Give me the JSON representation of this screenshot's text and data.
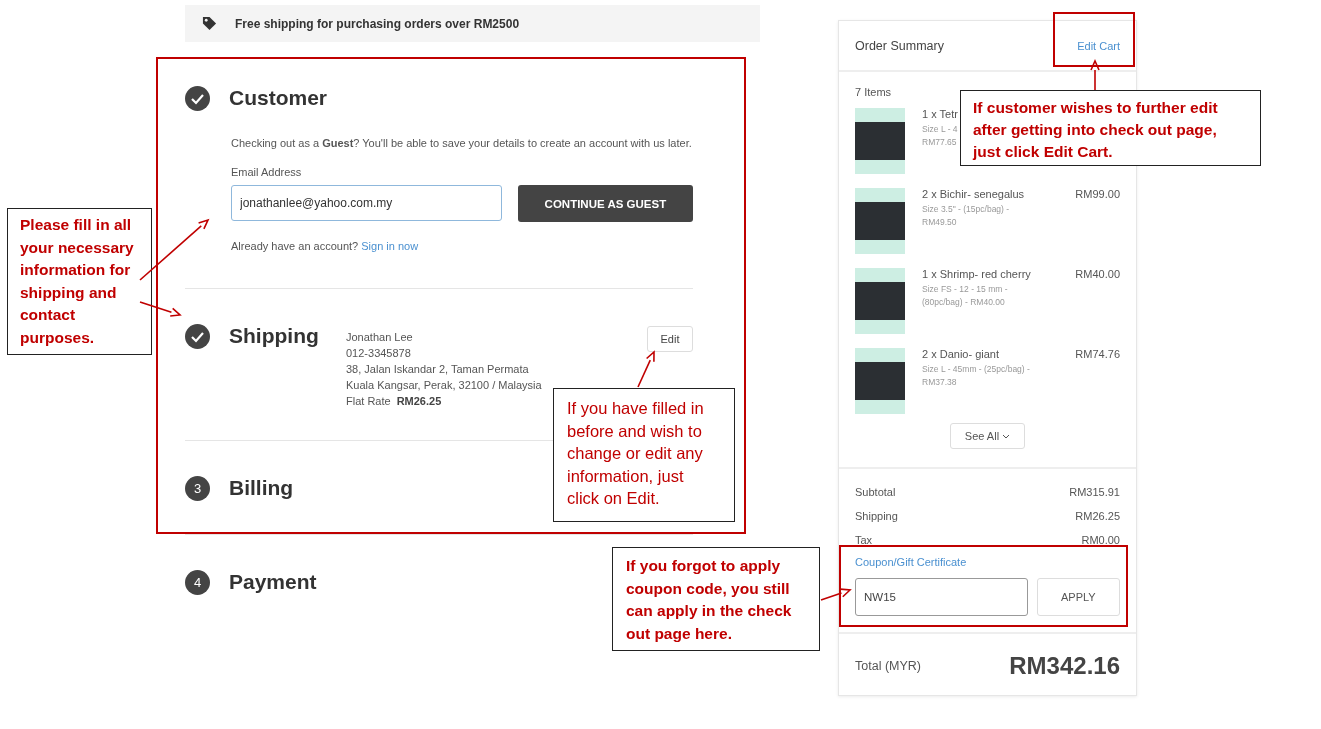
{
  "banner": {
    "text": "Free shipping for purchasing orders over RM2500"
  },
  "steps": [
    {
      "kind": "customer",
      "title": "Customer",
      "completed": true,
      "intro": "Checking out as a **Guest**? You'll be able to save your details to create an account with us later.",
      "email_label": "Email Address",
      "email_value": "jonathanlee@yahoo.com.my",
      "continue_button": "CONTINUE AS GUEST",
      "signin_prompt": "Already have an account?",
      "signin_link": "Sign in now"
    },
    {
      "kind": "shipping",
      "title": "Shipping",
      "completed": true,
      "address_lines": [
        "Jonathan Lee",
        "012-3345878",
        "38, Jalan Iskandar 2, Taman Permata",
        "Kuala Kangsar, Perak, 32100 / Malaysia"
      ],
      "rate_label": "Flat Rate",
      "rate_value": "RM26.25",
      "edit_button": "Edit"
    },
    {
      "kind": "billing",
      "title": "Billing",
      "completed": false,
      "number": "3"
    },
    {
      "kind": "payment",
      "title": "Payment",
      "completed": false,
      "number": "4"
    }
  ],
  "order_summary": {
    "title": "Order Summary",
    "edit_cart": "Edit Cart",
    "item_count": "7 Items",
    "items": [
      {
        "name": "1 x Tetr",
        "details": [
          "Size L - 4",
          "RM77.65"
        ]
      },
      {
        "name": "2 x Bichir- senegalus",
        "details": [
          "Size 3.5\" - (15pc/bag) -",
          "RM49.50"
        ],
        "price": "RM99.00"
      },
      {
        "name": "1 x Shrimp- red cherry",
        "details": [
          "Size FS - 12 - 15 mm -",
          "(80pc/bag) - RM40.00"
        ],
        "price": "RM40.00"
      },
      {
        "name": "2 x Danio- giant",
        "details": [
          "Size L - 45mm - (25pc/bag) -",
          "RM37.38"
        ],
        "price": "RM74.76"
      }
    ],
    "see_all": "See All",
    "totals": [
      {
        "label": "Subtotal",
        "value": "RM315.91"
      },
      {
        "label": "Shipping",
        "value": "RM26.25"
      },
      {
        "label": "Tax",
        "value": "RM0.00"
      }
    ],
    "coupon_label": "Coupon/Gift Certificate",
    "coupon_value": "NW15",
    "apply_button": "APPLY",
    "total_label": "Total (MYR)",
    "total_value": "RM342.16"
  },
  "annotations": [
    {
      "text": "Please fill in all your necessary information for shipping and contact purposes."
    },
    {
      "text": "If you have filled in before and wish to change or edit any information, just click on Edit."
    },
    {
      "text": "If customer wishes to further edit after getting into check out page, just click Edit Cart."
    },
    {
      "text": "If you forgot to apply coupon code, you still can apply in the check out page here."
    }
  ]
}
